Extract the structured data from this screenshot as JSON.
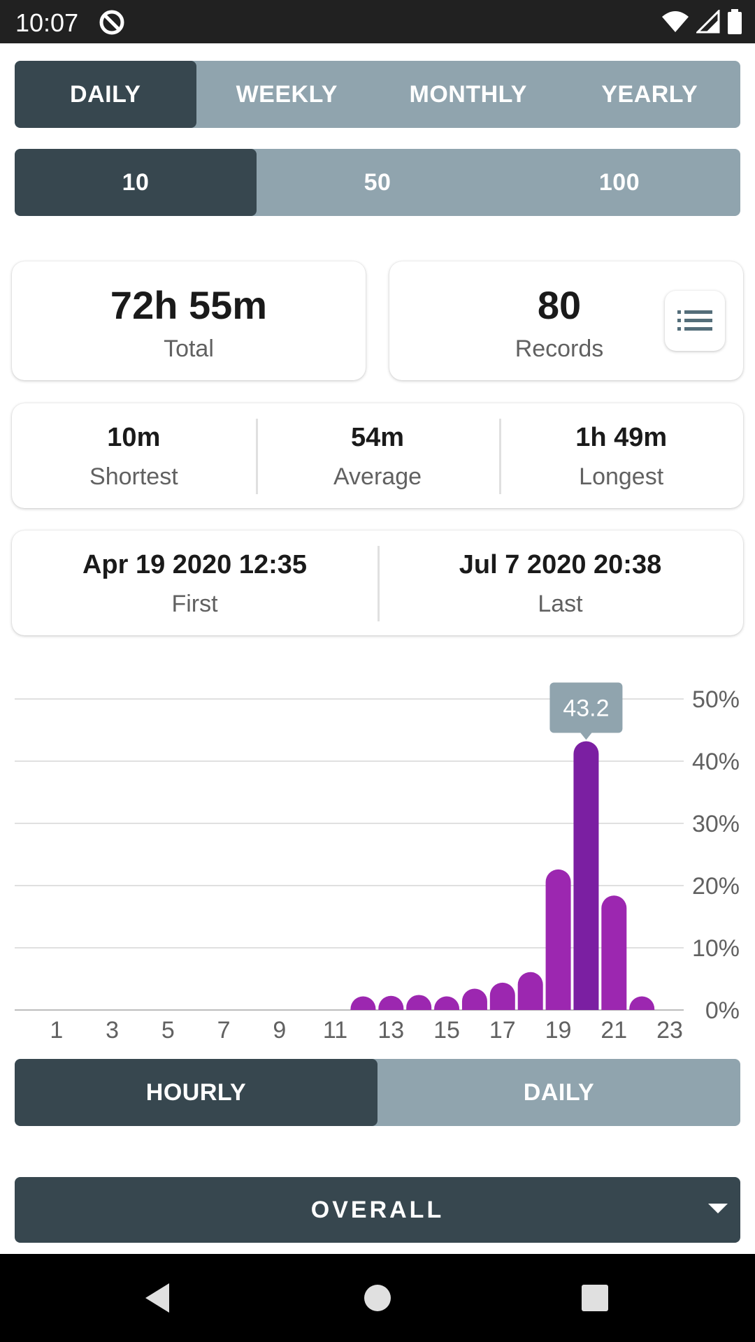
{
  "status_bar": {
    "time": "10:07"
  },
  "period_tabs": [
    {
      "label": "DAILY",
      "active": true
    },
    {
      "label": "WEEKLY",
      "active": false
    },
    {
      "label": "MONTHLY",
      "active": false
    },
    {
      "label": "YEARLY",
      "active": false
    }
  ],
  "count_tabs": [
    {
      "label": "10",
      "active": true
    },
    {
      "label": "50",
      "active": false
    },
    {
      "label": "100",
      "active": false
    }
  ],
  "summary": {
    "total_value": "72h 55m",
    "total_label": "Total",
    "records_value": "80",
    "records_label": "Records"
  },
  "stats": {
    "shortest_value": "10m",
    "shortest_label": "Shortest",
    "average_value": "54m",
    "average_label": "Average",
    "longest_value": "1h 49m",
    "longest_label": "Longest"
  },
  "dates": {
    "first_value": "Apr 19 2020 12:35",
    "first_label": "First",
    "last_value": "Jul 7 2020 20:38",
    "last_label": "Last"
  },
  "chart_data": {
    "type": "bar",
    "categories": [
      "0",
      "1",
      "2",
      "3",
      "4",
      "5",
      "6",
      "7",
      "8",
      "9",
      "10",
      "11",
      "12",
      "13",
      "14",
      "15",
      "16",
      "17",
      "18",
      "19",
      "20",
      "21",
      "22",
      "23"
    ],
    "values": [
      0,
      0,
      0,
      0,
      0,
      0,
      0,
      0,
      0,
      0,
      0,
      0,
      0.3,
      0.5,
      0.8,
      0.1,
      2.8,
      4.4,
      6.1,
      22.6,
      43.2,
      18.4,
      0.1,
      0
    ],
    "tick_labels": [
      "1",
      "3",
      "5",
      "7",
      "9",
      "11",
      "13",
      "15",
      "17",
      "19",
      "21",
      "23"
    ],
    "y_ticks": [
      "0%",
      "10%",
      "20%",
      "30%",
      "40%",
      "50%"
    ],
    "ylim": [
      0,
      50
    ],
    "highlight_index": 20,
    "highlight_label": "43.2",
    "bar_color": "#9c27b0",
    "highlight_color": "#7b1fa2",
    "grid": true
  },
  "chart_tabs": [
    {
      "label": "HOURLY",
      "active": true
    },
    {
      "label": "DAILY",
      "active": false
    }
  ],
  "overall": {
    "label": "OVERALL"
  }
}
